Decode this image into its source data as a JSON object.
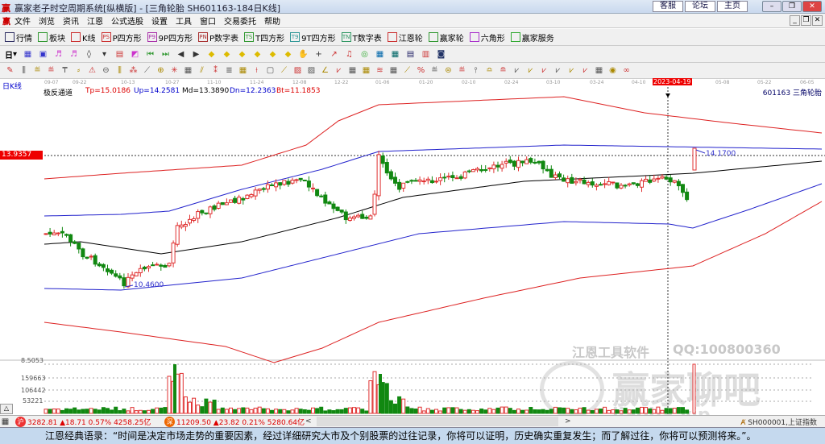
{
  "window": {
    "title": "赢家老子时空周期系统[纵横版] - [三角轮胎  SH601163-184日K线]",
    "links": [
      "客服",
      "论坛",
      "主页"
    ],
    "controls": [
      "–",
      "❐",
      "✕"
    ]
  },
  "menu": [
    "文件",
    "浏览",
    "资讯",
    "江恩",
    "公式选股",
    "设置",
    "工具",
    "窗口",
    "交易委托",
    "帮助"
  ],
  "toolbar": [
    {
      "icon": "grid",
      "label": "行情"
    },
    {
      "icon": "blocks",
      "label": "板块"
    },
    {
      "icon": "kline",
      "label": "K线"
    },
    {
      "icon": "PS",
      "label": "P四方形"
    },
    {
      "icon": "P9",
      "label": "9P四方形"
    },
    {
      "icon": "PN",
      "label": "P数字表"
    },
    {
      "icon": "TS",
      "label": "T四方形"
    },
    {
      "icon": "T9",
      "label": "9T四方形"
    },
    {
      "icon": "TN",
      "label": "T数字表"
    },
    {
      "icon": "target",
      "label": "江恩轮"
    },
    {
      "icon": "wheel",
      "label": "赢家轮"
    },
    {
      "icon": "hexagon",
      "label": "六角形"
    },
    {
      "icon": "dollar",
      "label": "赢家服务"
    }
  ],
  "period_label": "日",
  "chart": {
    "period": "日K线",
    "dates": [
      "09-07",
      "09-22",
      "10-13",
      "10-27",
      "11-10",
      "11-24",
      "12-08",
      "12-22",
      "01-06",
      "01-20",
      "02-10",
      "02-24",
      "03-10",
      "03-24",
      "04-10",
      "2023-04-19",
      "05-08",
      "05-22",
      "06-05"
    ],
    "indicator": {
      "name": "极反通道",
      "tp": "Tp=15.0186",
      "up": "Up=14.2581",
      "md": "Md=13.3890",
      "dn": "Dn=12.2363",
      "bt": "Bt=11.1853"
    },
    "stock": "601163 三角轮胎",
    "cursor_price": "13.9357",
    "low_label": "10.4600",
    "high_label": "14.1700",
    "vol_axis": [
      "8.5053",
      "159663",
      "106442",
      "53221"
    ],
    "colors": {
      "up": "#e03030",
      "down": "#118811",
      "band_outer": "#dd2222",
      "band_inner": "#2222cc",
      "mid": "#000000"
    }
  },
  "watermark": {
    "tool": "江恩工具软件",
    "qq": "QQ:100800360",
    "brand": "赢家聊吧",
    "site": "liaoba.vip"
  },
  "status": {
    "sh_icon": "沪",
    "sh": "3282.81 ▲18.71 0.57% 4258.25亿",
    "sz_icon": "深",
    "sz": "11209.50 ▲23.82 0.21% 5280.64亿",
    "index": "SH000001,上证指数",
    "scroll_left": "<",
    "scroll_right": ">",
    "toggle": "△"
  },
  "quote": "江恩经典语录：“时间是决定市场走势的重要因素，经过详细研究大市及个别股票的过往记录，你将可以证明，历史确实重复发生；而了解过往，你将可以预测将来。”。"
}
